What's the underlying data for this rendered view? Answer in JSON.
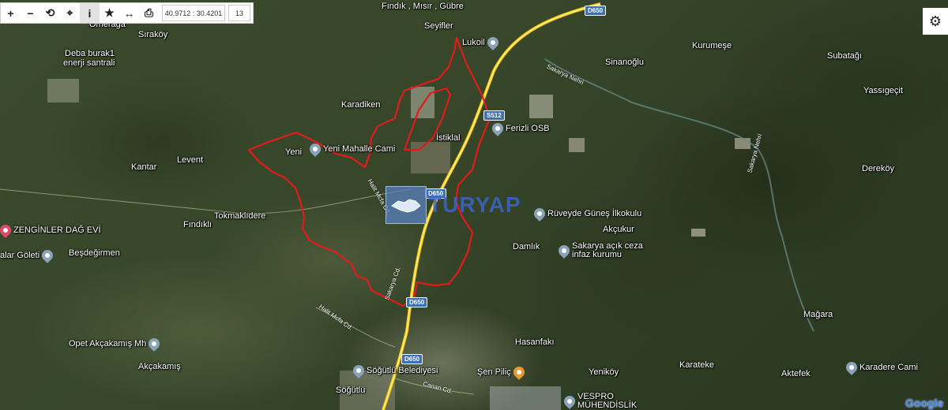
{
  "toolbar": {
    "zoom_in": "+",
    "zoom_out": "−",
    "refresh": "⟲",
    "locate": "⌖",
    "info": "i",
    "favorite": "★",
    "measure": "↔",
    "print": "⎙",
    "coordinates": "40.9712 : 30.4201",
    "zoom_level": "13"
  },
  "settings": {
    "icon": "⚙"
  },
  "attribution": "Google",
  "watermark": "TURYAP",
  "labels": {
    "findik_misir_gubre": "Fındık , Mısır , Gübre",
    "seyifler": "Seyifler",
    "lukoil": "Lukoil",
    "omeraga": "Omerağa",
    "sirakoy": "Sıraköy",
    "deba": "Deba burak1",
    "deba2": "enerji santrali",
    "kurumese": "Kurumeşe",
    "subatagi": "Subatağı",
    "sinanoglu": "Sinanoğlu",
    "yassigecit": "Yassıgeçit",
    "karadiken": "Karadiken",
    "ferizli_osb": "Ferizli OSB",
    "istiklal": "İstiklal",
    "yeni": "Yeni",
    "yeni_mahalle_cami": "Yeni Mahalle Cami",
    "levent": "Levent",
    "kantar": "Kantar",
    "derekoy": "Dereköy",
    "tokmaklidere": "Tokmaklıdere",
    "ruveyde": "Rüveyde Güneş İlkokulu",
    "zenginler": "ZENGİNLER DAĞ EVİ",
    "findikli": "Fındıklı",
    "akcukur": "Akçukur",
    "golet": "alar Göleti",
    "besdegirmen": "Beşdeğirmen",
    "damlik": "Damlık",
    "sakarya_acik": "Sakarya açık ceza",
    "sakarya_acik2": "infaz kurumu",
    "magara": "Mağara",
    "opet": "Opet Akçakamış Mh",
    "hasanfaki": "Hasanfakı",
    "akcakamis": "Akçakamış",
    "karateke": "Karateke",
    "sogutlu_bel": "Söğütlü Belediyesi",
    "sen_pilic": "Şen Piliç",
    "yenikoy": "Yeniköy",
    "aktefek": "Aktefek",
    "karadere_cami": "Karadere Cami",
    "sogutlu": "Söğütlü",
    "vespro": "VESPRO",
    "vespro2": "MÜHENDİSLİK"
  },
  "roads": {
    "d650_a": "D650",
    "d650_b": "D650",
    "d650_c": "D650",
    "d650_d": "D650",
    "s512": "S512",
    "sakarya_nehri": "Sakarya Nehri",
    "sakarya_nehri2": "Sakarya Nehri",
    "sakarya_cd": "Sakarya Cd.",
    "halit_mcl": "Halit Mcfa Cd.",
    "halit_mcl2": "Halit Mcfa Cd.",
    "canan_cd": "Canan Cd."
  }
}
